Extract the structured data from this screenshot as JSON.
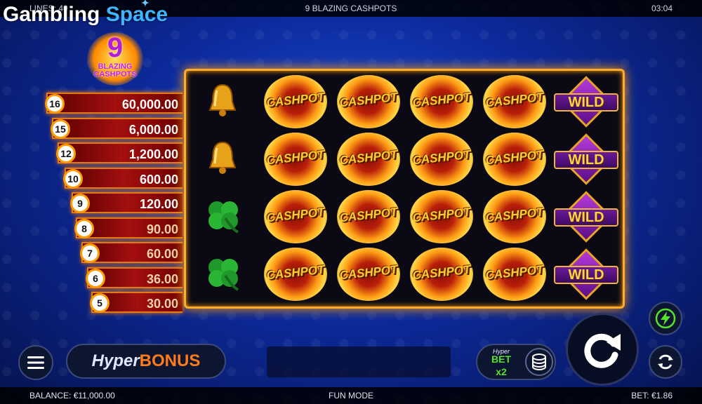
{
  "topbar": {
    "lines": "LINES: 40",
    "title": "9 BLAZING CASHPOTS",
    "clock": "03:04"
  },
  "brand": {
    "part1": "Gambling",
    "part2": "Space"
  },
  "logo": {
    "number": "9",
    "line1": "BLAZING",
    "line2": "CASHPOTS"
  },
  "ladder": [
    {
      "count": "16",
      "value": "60,000.00"
    },
    {
      "count": "15",
      "value": "6,000.00"
    },
    {
      "count": "12",
      "value": "1,200.00"
    },
    {
      "count": "10",
      "value": "600.00"
    },
    {
      "count": "9",
      "value": "120.00"
    },
    {
      "count": "8",
      "value": "90.00"
    },
    {
      "count": "7",
      "value": "60.00"
    },
    {
      "count": "6",
      "value": "36.00"
    },
    {
      "count": "5",
      "value": "30.00"
    }
  ],
  "reels": {
    "grid": [
      [
        "bell",
        "cashpot",
        "cashpot",
        "cashpot",
        "cashpot",
        "wild"
      ],
      [
        "bell",
        "cashpot",
        "cashpot",
        "cashpot",
        "cashpot",
        "wild"
      ],
      [
        "clover",
        "cashpot",
        "cashpot",
        "cashpot",
        "cashpot",
        "wild"
      ],
      [
        "clover",
        "cashpot",
        "cashpot",
        "cashpot",
        "cashpot",
        "wild"
      ]
    ],
    "cashpot_label": "CASHPOT",
    "wild_label": "WILD"
  },
  "controls": {
    "hyper": "Hyper",
    "bonus": "BONUS",
    "hyperbet_top": "Hyper",
    "hyperbet_bet": "BET",
    "hyperbet_mult": "x2",
    "menu_icon": "hamburger-icon",
    "spin_icon": "spin-arrow-icon",
    "turbo_icon": "lightning-icon",
    "autoplay_icon": "autoplay-icon",
    "stake_icon": "coin-stack-icon"
  },
  "bottombar": {
    "balance": "BALANCE: €11,000.00",
    "mode": "FUN MODE",
    "bet": "BET: €1.86"
  },
  "colors": {
    "accent_orange": "#ff9c00",
    "turbo_green": "#55e22a",
    "bonus_orange": "#ff7a1a"
  }
}
